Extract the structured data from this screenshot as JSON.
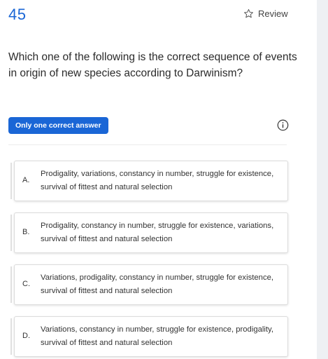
{
  "question": {
    "number": "45",
    "review_label": "Review",
    "text": "Which one of the following is the correct sequence of events in origin of new species according to Darwinism?",
    "answer_type": "Only one correct answer"
  },
  "options": [
    {
      "letter": "A.",
      "text": "Prodigality, variations, constancy in number, struggle for existence, survival of fittest and natural selection"
    },
    {
      "letter": "B.",
      "text": "Prodigality, constancy in number, struggle for existence, variations, survival of fittest and natural selection"
    },
    {
      "letter": "C.",
      "text": "Variations, prodigality, constancy in number, struggle for existence, survival of fittest and natural selection"
    },
    {
      "letter": "D.",
      "text": "Variations, constancy in number, struggle for existence, prodigality, survival of fittest and natural selection"
    }
  ],
  "icons": {
    "review": "star-outline-icon",
    "info": "info-icon"
  },
  "colors": {
    "accent": "#1a66d6"
  }
}
